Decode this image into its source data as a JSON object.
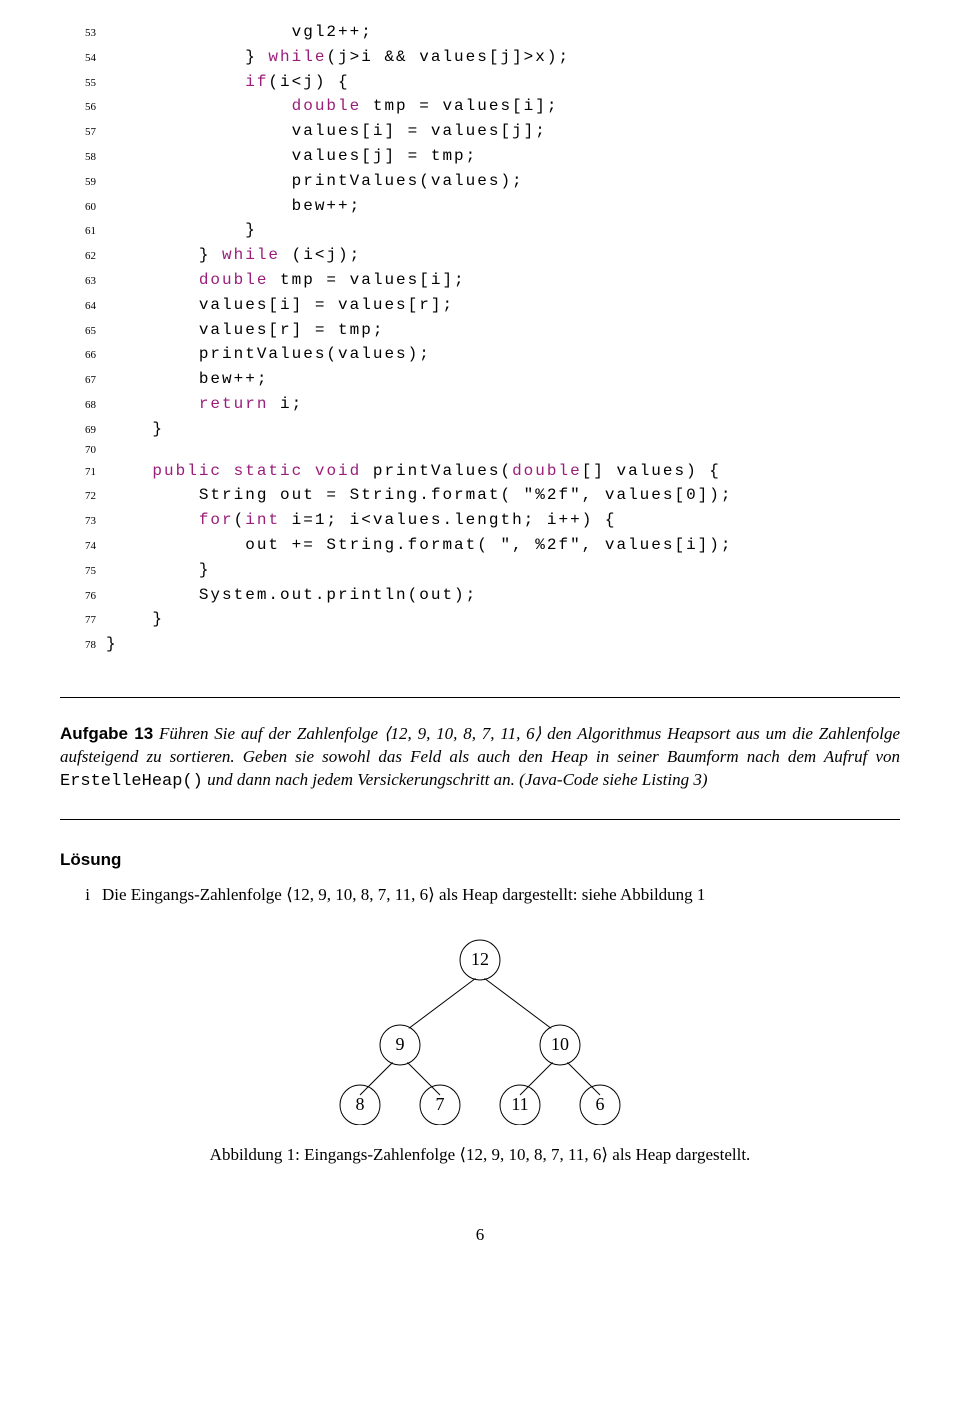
{
  "code": {
    "lines": [
      {
        "n": "53",
        "t": "                vgl2++;"
      },
      {
        "n": "54",
        "t": "            } while(j>i && values[j]>x);"
      },
      {
        "n": "55",
        "t": "            if(i<j) {"
      },
      {
        "n": "56",
        "t": "                double tmp = values[i];"
      },
      {
        "n": "57",
        "t": "                values[i] = values[j];"
      },
      {
        "n": "58",
        "t": "                values[j] = tmp;"
      },
      {
        "n": "59",
        "t": "                printValues(values);"
      },
      {
        "n": "60",
        "t": "                bew++;"
      },
      {
        "n": "61",
        "t": "            }"
      },
      {
        "n": "62",
        "t": "        } while (i<j);"
      },
      {
        "n": "63",
        "t": "        double tmp = values[i];"
      },
      {
        "n": "64",
        "t": "        values[i] = values[r];"
      },
      {
        "n": "65",
        "t": "        values[r] = tmp;"
      },
      {
        "n": "66",
        "t": "        printValues(values);"
      },
      {
        "n": "67",
        "t": "        bew++;"
      },
      {
        "n": "68",
        "t": "        return i;"
      },
      {
        "n": "69",
        "t": "    }"
      },
      {
        "n": "70",
        "t": ""
      },
      {
        "n": "71",
        "t": "    public static void printValues(double[] values) {"
      },
      {
        "n": "72",
        "t": "        String out = String.format( \"%2f\", values[0]);"
      },
      {
        "n": "73",
        "t": "        for(int i=1; i<values.length; i++) {"
      },
      {
        "n": "74",
        "t": "            out += String.format( \", %2f\", values[i]);"
      },
      {
        "n": "75",
        "t": "        }"
      },
      {
        "n": "76",
        "t": "        System.out.println(out);"
      },
      {
        "n": "77",
        "t": "    }"
      },
      {
        "n": "78",
        "t": "}"
      }
    ]
  },
  "aufgabe": {
    "label": "Aufgabe 13",
    "sep": "    ",
    "text_prefix": "Führen Sie auf der Zahlenfolge ⟨12, 9, 10, 8, 7, 11, 6⟩ den Algorithmus Heapsort aus um die Zahlenfolge aufsteigend zu sortieren. Geben sie sowohl das Feld als auch den Heap in seiner Baumform nach dem Aufruf von ",
    "tt": "ErstelleHeap()",
    "text_suffix": " und dann nach jedem Versickerungschritt an. (Java-Code siehe Listing 3)"
  },
  "loesung": {
    "title": "Lösung",
    "item_label": "i",
    "item_text": "Die Eingangs-Zahlenfolge ⟨12, 9, 10, 8, 7, 11, 6⟩ als Heap dargestellt: siehe Abbildung 1"
  },
  "tree": {
    "nodes": {
      "root": "12",
      "l": "9",
      "r": "10",
      "ll": "8",
      "lr": "7",
      "rl": "11",
      "rr": "6"
    }
  },
  "caption": "Abbildung 1: Eingangs-Zahlenfolge ⟨12, 9, 10, 8, 7, 11, 6⟩ als Heap dargestellt.",
  "page_number": "6"
}
